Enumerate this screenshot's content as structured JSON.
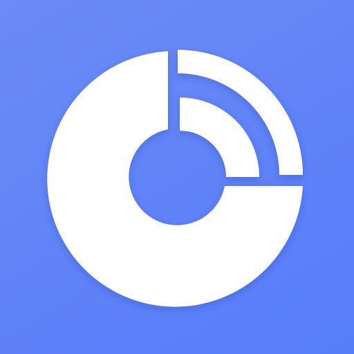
{
  "icon": {
    "name": "disc-signal-icon",
    "background_color": "#5F82F7",
    "foreground_color": "#FFFFFF"
  }
}
